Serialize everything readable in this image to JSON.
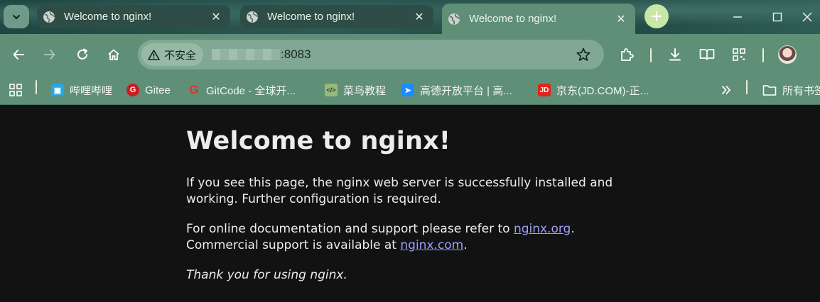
{
  "browser": {
    "tabs": [
      {
        "title": "Welcome to nginx!",
        "active": false
      },
      {
        "title": "Welcome to nginx!",
        "active": false
      },
      {
        "title": "Welcome to nginx!",
        "active": true
      }
    ],
    "address_bar": {
      "security_label": "不安全",
      "url_visible": ":8083"
    },
    "bookmarks": [
      {
        "label": "哔哩哔哩",
        "icon": "bilibili-icon"
      },
      {
        "label": "Gitee",
        "icon": "gitee-icon"
      },
      {
        "label": "GitCode - 全球开...",
        "icon": "gitcode-icon"
      },
      {
        "label": "菜鸟教程",
        "icon": "runoob-icon"
      },
      {
        "label": "高德开放平台 | 高...",
        "icon": "amap-icon"
      },
      {
        "label": "京东(JD.COM)-正...",
        "icon": "jd-icon"
      }
    ],
    "all_bookmarks_label": "所有书签"
  },
  "page": {
    "heading": "Welcome to nginx!",
    "para1": "If you see this page, the nginx web server is successfully installed and working. Further configuration is required.",
    "para2_prefix": "For online documentation and support please refer to ",
    "para2_link1": "nginx.org",
    "para2_mid": ".\nCommercial support is available at ",
    "para2_link2": "nginx.com",
    "para2_suffix": ".",
    "thanks": "Thank you for using nginx."
  },
  "colors": {
    "frame": "#5f8f77",
    "page_bg": "#121212",
    "link": "#9e9eff"
  }
}
